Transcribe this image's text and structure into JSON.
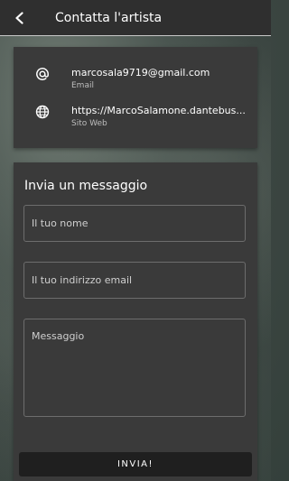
{
  "appbar": {
    "title": "Contatta l'artista",
    "back_icon": "chevron-left-icon"
  },
  "contacts": [
    {
      "icon": "at-sign-icon",
      "value": "marcosala9719@gmail.com",
      "label": "Email"
    },
    {
      "icon": "globe-icon",
      "value": "https://MarcoSalamone.dantebus...",
      "label": "Sito Web"
    }
  ],
  "message_form": {
    "title": "Invia un messaggio",
    "name_placeholder": "Il tuo nome",
    "email_placeholder": "Il tuo indirizzo email",
    "message_placeholder": "Messaggio",
    "send_label": "INVIA!"
  },
  "colors": {
    "card": "#3a3a3a",
    "appbar": "#2f2f2f",
    "button": "#1f1f1f"
  }
}
